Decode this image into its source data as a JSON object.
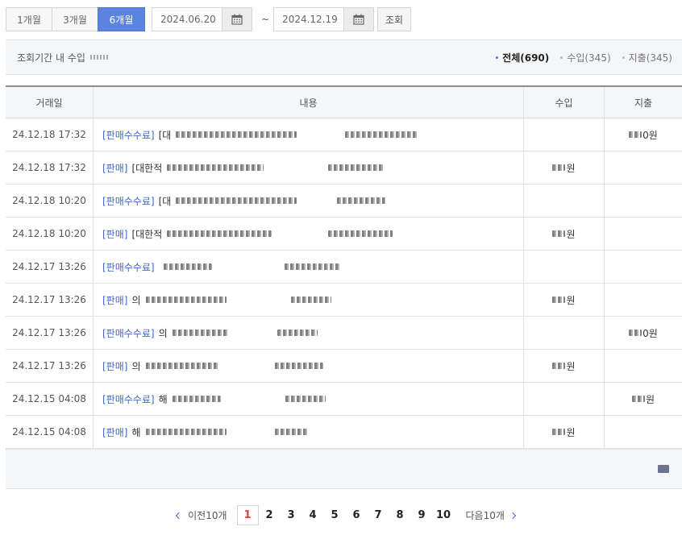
{
  "periods": {
    "one_month": "1개월",
    "three_months": "3개월",
    "six_months": "6개월"
  },
  "date_range": {
    "start": "2024.06.20",
    "separator": "~",
    "end": "2024.12.19"
  },
  "search_label": "조회",
  "summary": {
    "label": "조회기간 내 수입",
    "filters": {
      "all": "전체(690)",
      "income": "수입(345)",
      "expense": "지출(345)"
    }
  },
  "table": {
    "headers": {
      "date": "거래일",
      "content": "내용",
      "income": "수입",
      "expense": "지출"
    },
    "rows": [
      {
        "date": "24.12.18 17:32",
        "category": "[판매수수료]",
        "title": "[대",
        "income": "",
        "expense": "0원"
      },
      {
        "date": "24.12.18 17:32",
        "category": "[판매]",
        "title": "[대한적",
        "income": "원",
        "expense": ""
      },
      {
        "date": "24.12.18 10:20",
        "category": "[판매수수료]",
        "title": "[대",
        "income": "",
        "expense": ""
      },
      {
        "date": "24.12.18 10:20",
        "category": "[판매]",
        "title": "[대한적",
        "income": "원",
        "expense": ""
      },
      {
        "date": "24.12.17 13:26",
        "category": "[판매수수료]",
        "title": "",
        "income": "",
        "expense": ""
      },
      {
        "date": "24.12.17 13:26",
        "category": "[판매]",
        "title": "의",
        "income": "원",
        "expense": ""
      },
      {
        "date": "24.12.17 13:26",
        "category": "[판매수수료]",
        "title": "의",
        "income": "",
        "expense": "0원"
      },
      {
        "date": "24.12.17 13:26",
        "category": "[판매]",
        "title": "의",
        "income": "원",
        "expense": ""
      },
      {
        "date": "24.12.15 04:08",
        "category": "[판매수수료]",
        "title": "해",
        "income": "",
        "expense": "원"
      },
      {
        "date": "24.12.15 04:08",
        "category": "[판매]",
        "title": "해",
        "income": "원",
        "expense": ""
      }
    ]
  },
  "pagination": {
    "prev_label": "이전10개",
    "next_label": "다음10개",
    "pages": [
      "1",
      "2",
      "3",
      "4",
      "5",
      "6",
      "7",
      "8",
      "9",
      "10"
    ],
    "current": "1"
  },
  "colors": {
    "accent": "#5b84e0",
    "link": "#3f67c4",
    "current_page": "#e04040"
  },
  "icons": {
    "calendar": "calendar-icon",
    "prev": "chevron-left-icon",
    "next": "chevron-right-icon"
  }
}
